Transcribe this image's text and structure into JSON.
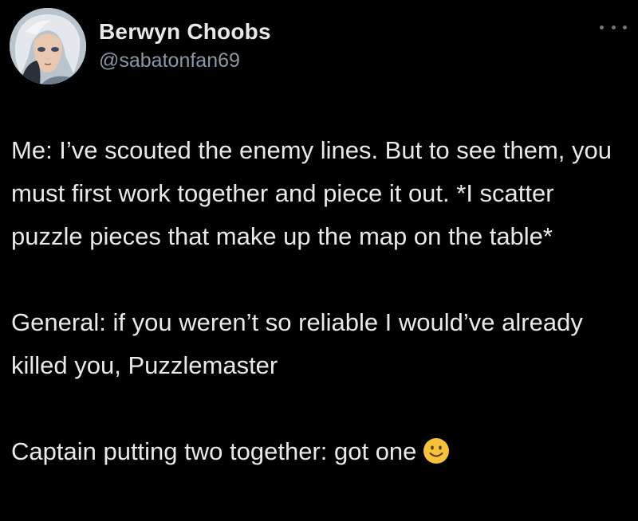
{
  "tweet": {
    "author": {
      "display_name": "Berwyn Choobs",
      "handle": "@sabatonfan69",
      "avatar_icon": "anime-character-avatar"
    },
    "more_icon": "more-options-icon",
    "paragraphs": [
      "Me: I’ve scouted the enemy lines. But to see them, you must first work together and piece it out. *I scatter puzzle pieces that make up the map on the table*",
      "General: if you weren’t so reliable I would’ve already killed you, Puzzlemaster",
      "Captain putting two together: got one"
    ],
    "trailing_emoji": "slightly-smiling-face-icon",
    "colors": {
      "background": "#000000",
      "text": "#e7e9ea",
      "secondary_text": "#8b98a5",
      "emoji": "#f7c23a"
    }
  }
}
